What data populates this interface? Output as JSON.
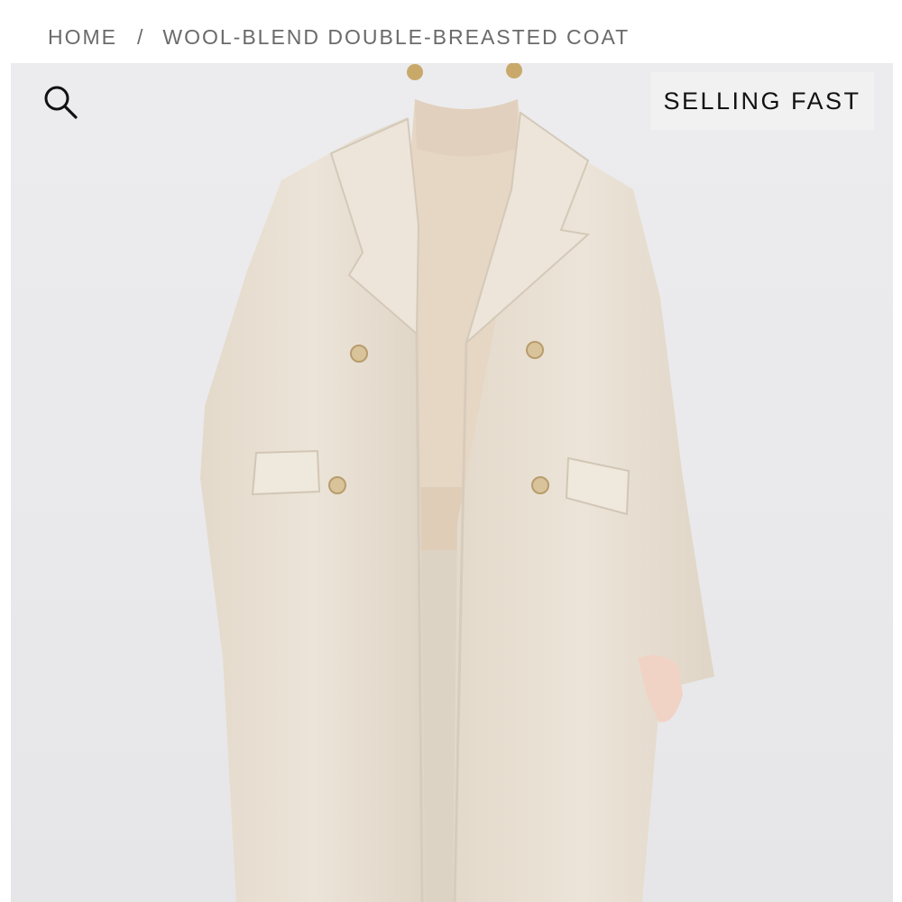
{
  "breadcrumb": {
    "home": "HOME",
    "separator": "/",
    "current": "WOOL-BLEND DOUBLE-BREASTED COAT"
  },
  "product_image": {
    "badge": "SELLING FAST",
    "search_icon": "search-icon",
    "background_color": "#ebebed",
    "coat_color": "#e9e0d3",
    "button_color": "#d9c39b"
  }
}
